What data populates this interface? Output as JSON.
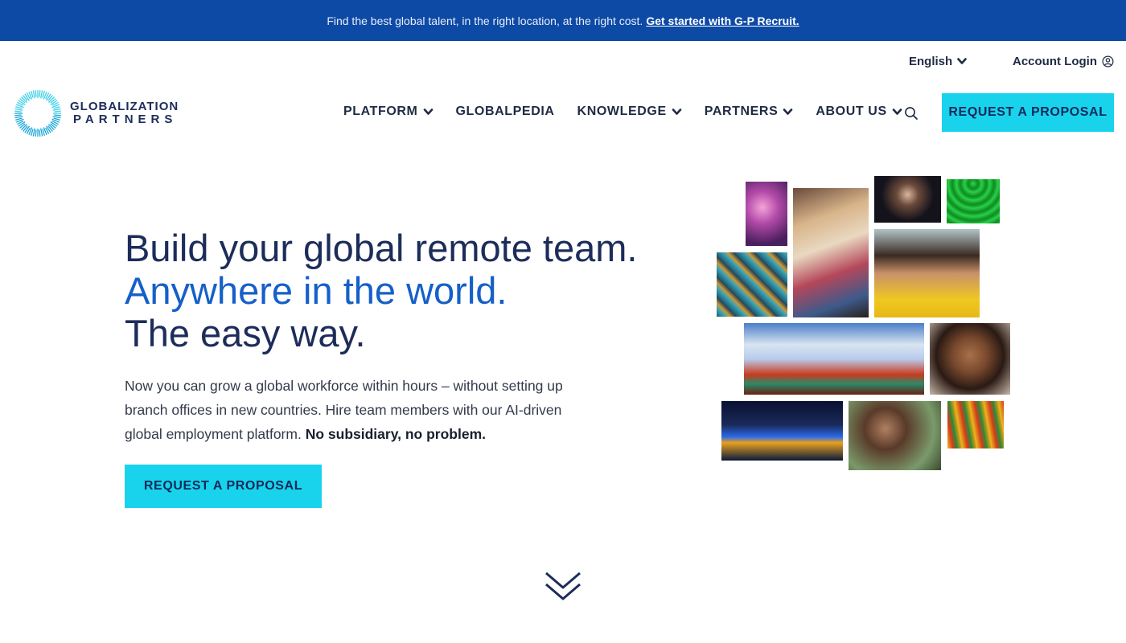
{
  "banner": {
    "text": "Find the best global talent, in the right location, at the right cost.",
    "link": "Get started with G-P Recruit."
  },
  "utility": {
    "language": "English",
    "login": "Account Login"
  },
  "logo": {
    "line1": "GLOBALIZATION",
    "line2": "PARTNERS"
  },
  "nav": {
    "items": [
      {
        "label": "PLATFORM",
        "dropdown": true
      },
      {
        "label": "GLOBALPEDIA",
        "dropdown": false
      },
      {
        "label": "KNOWLEDGE",
        "dropdown": true
      },
      {
        "label": "PARTNERS",
        "dropdown": true
      },
      {
        "label": "ABOUT US",
        "dropdown": true
      }
    ],
    "cta": "REQUEST A PROPOSAL"
  },
  "hero": {
    "line1": "Build your global remote team.",
    "line2": "Anywhere in the world.",
    "line3": "The easy way.",
    "body": "Now you can grow a global workforce within hours – without setting up branch offices in new countries. Hire team members with our AI-driven global employment platform.",
    "body_bold": "No subsidiary, no problem.",
    "cta": "REQUEST A PROPOSAL"
  },
  "icons": {
    "language_chevron": "chevron-down-icon",
    "login": "user-circle-icon",
    "search": "search-icon",
    "scroll": "double-chevron-down-icon"
  },
  "colors": {
    "banner": "#0d4aa6",
    "cta": "#19d3ec",
    "navy": "#1c2d5a",
    "accent_blue": "#1560c8"
  }
}
